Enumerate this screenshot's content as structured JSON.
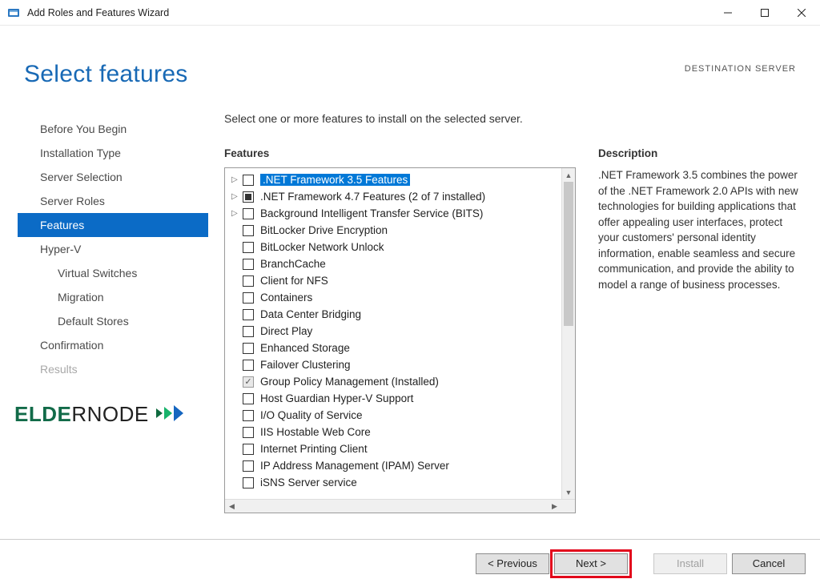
{
  "window": {
    "title": "Add Roles and Features Wizard"
  },
  "header": {
    "page_title": "Select features",
    "destination_label": "DESTINATION SERVER"
  },
  "nav": {
    "items": [
      {
        "label": "Before You Begin",
        "active": false
      },
      {
        "label": "Installation Type",
        "active": false
      },
      {
        "label": "Server Selection",
        "active": false
      },
      {
        "label": "Server Roles",
        "active": false
      },
      {
        "label": "Features",
        "active": true
      },
      {
        "label": "Hyper-V",
        "active": false
      },
      {
        "label": "Virtual Switches",
        "active": false,
        "sub": true
      },
      {
        "label": "Migration",
        "active": false,
        "sub": true
      },
      {
        "label": "Default Stores",
        "active": false,
        "sub": true
      },
      {
        "label": "Confirmation",
        "active": false
      },
      {
        "label": "Results",
        "active": false,
        "disabled": true
      }
    ]
  },
  "main": {
    "instruction": "Select one or more features to install on the selected server.",
    "features_heading": "Features",
    "description_heading": "Description",
    "description_text": ".NET Framework 3.5 combines the power of the .NET Framework 2.0 APIs with new technologies for building applications that offer appealing user interfaces, protect your customers' personal identity information, enable seamless and secure communication, and provide the ability to model a range of business processes.",
    "features": [
      {
        "label": ".NET Framework 3.5 Features",
        "expander": true,
        "check": "empty",
        "highlight": true
      },
      {
        "label": ".NET Framework 4.7 Features (2 of 7 installed)",
        "expander": true,
        "check": "indet"
      },
      {
        "label": "Background Intelligent Transfer Service (BITS)",
        "expander": true,
        "check": "empty"
      },
      {
        "label": "BitLocker Drive Encryption",
        "expander": false,
        "check": "empty"
      },
      {
        "label": "BitLocker Network Unlock",
        "expander": false,
        "check": "empty"
      },
      {
        "label": "BranchCache",
        "expander": false,
        "check": "empty"
      },
      {
        "label": "Client for NFS",
        "expander": false,
        "check": "empty"
      },
      {
        "label": "Containers",
        "expander": false,
        "check": "empty"
      },
      {
        "label": "Data Center Bridging",
        "expander": false,
        "check": "empty"
      },
      {
        "label": "Direct Play",
        "expander": false,
        "check": "empty"
      },
      {
        "label": "Enhanced Storage",
        "expander": false,
        "check": "empty"
      },
      {
        "label": "Failover Clustering",
        "expander": false,
        "check": "empty"
      },
      {
        "label": "Group Policy Management (Installed)",
        "expander": false,
        "check": "checked-disabled"
      },
      {
        "label": "Host Guardian Hyper-V Support",
        "expander": false,
        "check": "empty"
      },
      {
        "label": "I/O Quality of Service",
        "expander": false,
        "check": "empty"
      },
      {
        "label": "IIS Hostable Web Core",
        "expander": false,
        "check": "empty"
      },
      {
        "label": "Internet Printing Client",
        "expander": false,
        "check": "empty"
      },
      {
        "label": "IP Address Management (IPAM) Server",
        "expander": false,
        "check": "empty"
      },
      {
        "label": "iSNS Server service",
        "expander": false,
        "check": "empty"
      }
    ]
  },
  "buttons": {
    "previous": "< Previous",
    "next": "Next >",
    "install": "Install",
    "cancel": "Cancel"
  },
  "watermark": {
    "text_prefix": "ELDE",
    "text_suffix": "RNODE"
  }
}
